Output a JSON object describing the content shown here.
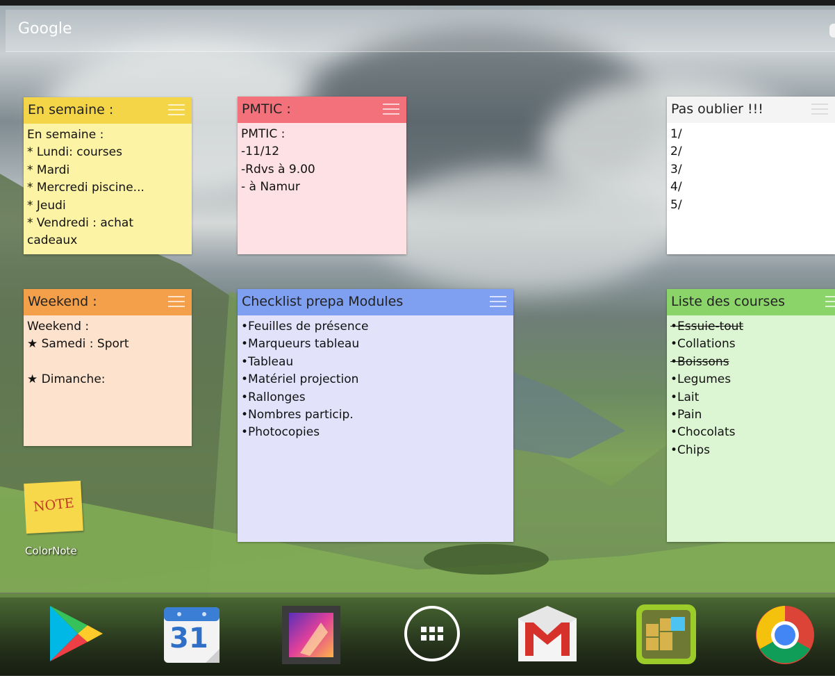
{
  "search": {
    "brand": "Google"
  },
  "notes": {
    "semaine": {
      "title": "En semaine :",
      "lines": [
        "En semaine :",
        "* Lundi: courses",
        "* Mardi",
        "* Mercredi piscine...",
        "* Jeudi",
        "* Vendredi : achat",
        "cadeaux"
      ]
    },
    "pmtic": {
      "title": "PMTIC :",
      "lines": [
        "PMTIC :",
        "-11/12",
        "-Rdvs à 9.00",
        "- à Namur"
      ]
    },
    "oublier": {
      "title": "Pas oublier !!!",
      "lines": [
        "1/",
        "2/",
        "3/",
        "4/",
        "5/"
      ]
    },
    "weekend": {
      "title": "Weekend :",
      "lines": [
        "Weekend :",
        "★ Samedi : Sport",
        "",
        "★ Dimanche:"
      ]
    },
    "checklist": {
      "title": "Checklist prepa Modules",
      "lines": [
        "•Feuilles de présence",
        "•Marqueurs tableau",
        "•Tableau",
        "•Matériel projection",
        "•Rallonges",
        "•Nombres particip.",
        "•Photocopies"
      ]
    },
    "courses": {
      "title": "Liste des courses",
      "lines": [
        "•Essuie-tout",
        "•Collations",
        "•Boissons",
        "•Legumes",
        "•Lait",
        "•Pain",
        "•Chocolats",
        "•Chips"
      ],
      "checked": [
        true,
        false,
        true,
        false,
        false,
        false,
        false,
        false
      ]
    }
  },
  "app_shortcut": {
    "icon_text": "NOTE",
    "label": "ColorNote"
  },
  "dock": {
    "apps": [
      "play-store-icon",
      "calendar-icon",
      "gallery-icon",
      "app-drawer-icon",
      "gmail-icon",
      "puzzle-game-icon",
      "chrome-icon"
    ],
    "calendar_day": "31"
  },
  "colors": {
    "yellow_header": "#f5d548",
    "yellow_body": "#fdf3a4",
    "red_header": "#f2717a",
    "red_body": "#fde1e4",
    "white_header": "#f4f4f4",
    "white_body": "#ffffff",
    "orange_header": "#f4a04a",
    "orange_body": "#fde3cd",
    "blue_header": "#7f9ff0",
    "blue_body": "#e2e3fb",
    "green_header": "#8bd46a",
    "green_body": "#dcf5d2"
  }
}
